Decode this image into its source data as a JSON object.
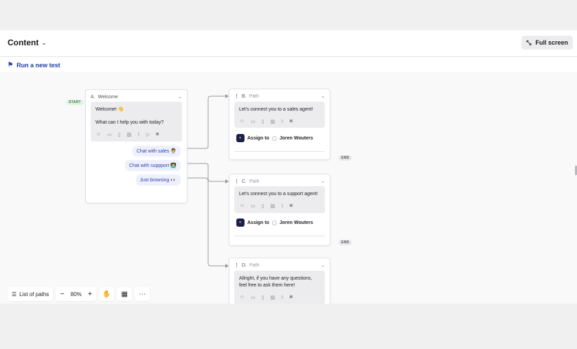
{
  "header": {
    "title": "Content",
    "full_screen_label": "Full screen"
  },
  "subbar": {
    "run_test_label": "Run a new test"
  },
  "badges": {
    "start": "START",
    "end": "END"
  },
  "cards": {
    "welcome": {
      "letter": "A.",
      "name": "Welcome",
      "message_line1": "Welcome! 👋",
      "message_line2": "What can I help you with today?",
      "replies": [
        "Chat with sales 🧑‍💼",
        "Chat with suppport 👩‍💻",
        "Just browsing 👀"
      ]
    },
    "b": {
      "letter": "B.",
      "name": "Path",
      "message": "Let's connect you to a sales agent!",
      "assign_label": "Assign to",
      "assignee": "Joren Wouters"
    },
    "c": {
      "letter": "C.",
      "name": "Path",
      "message": "Let's connect you to a support agent!",
      "assign_label": "Assign to",
      "assignee": "Joren Wouters"
    },
    "d": {
      "letter": "D.",
      "name": "Path",
      "message": "Allright, if you have any questions, feel free to ask them here!"
    }
  },
  "toolbar": {
    "list_paths_label": "List of paths",
    "zoom_level": "80%",
    "zoom_out": "−",
    "zoom_in": "+"
  },
  "icons": {
    "tools": [
      "emoji-icon",
      "gif-icon",
      "article-icon",
      "image-icon",
      "attachment-icon",
      "video-icon",
      "camera-icon"
    ]
  },
  "colors": {
    "accent": "#1f3ea8",
    "reply_bg": "#eef0fd",
    "start_badge": "#2e7d41"
  }
}
